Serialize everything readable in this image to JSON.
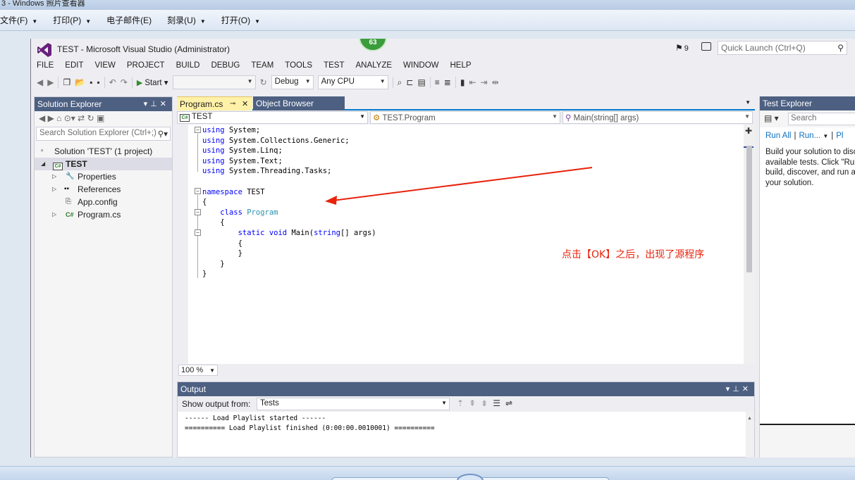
{
  "viewer": {
    "title": "3 - Windows 照片查看器",
    "menu": [
      "文件(F)",
      "打印(P)",
      "电子邮件(E)",
      "刻录(U)",
      "打开(O)"
    ]
  },
  "vs": {
    "title": "TEST - Microsoft Visual Studio (Administrator)",
    "badge": "63",
    "notifications": "9",
    "quick_launch_placeholder": "Quick Launch (Ctrl+Q)",
    "menu": [
      "FILE",
      "EDIT",
      "VIEW",
      "PROJECT",
      "BUILD",
      "DEBUG",
      "TEAM",
      "TOOLS",
      "TEST",
      "ANALYZE",
      "WINDOW",
      "HELP"
    ],
    "toolbar": {
      "start": "Start",
      "config": "Debug",
      "platform": "Any CPU"
    }
  },
  "solution_explorer": {
    "title": "Solution Explorer",
    "search_placeholder": "Search Solution Explorer (Ctrl+;)",
    "items": [
      {
        "label": "Solution 'TEST' (1 project)"
      },
      {
        "label": "TEST"
      },
      {
        "label": "Properties"
      },
      {
        "label": "References"
      },
      {
        "label": "App.config"
      },
      {
        "label": "Program.cs"
      }
    ]
  },
  "editor": {
    "tabs": [
      "Program.cs",
      "Object Browser"
    ],
    "nav": {
      "project": "TEST",
      "class": "TEST.Program",
      "member": "Main(string[] args)"
    },
    "code": {
      "using1": "System;",
      "using2": "System.Collections.Generic;",
      "using3": "System.Linq;",
      "using4": "System.Text;",
      "using5": "System.Threading.Tasks;",
      "using_kw": "using",
      "namespace_kw": "namespace",
      "namespace_name": " TEST",
      "brace_open": "{",
      "brace_close": "}",
      "class_kw": "class",
      "class_name": "Program",
      "static_kw": "static",
      "void_kw": "void",
      "main_name": " Main(",
      "string_kw": "string",
      "main_args": "[] args)"
    },
    "zoom": "100 %"
  },
  "annotation": "点击【OK】之后，出现了源程序",
  "output": {
    "title": "Output",
    "show_from_label": "Show output from:",
    "source": "Tests",
    "lines": [
      "------ Load Playlist started ------",
      "========== Load Playlist finished (0:00:00.0010001) =========="
    ]
  },
  "test_explorer": {
    "title": "Test Explorer",
    "search_placeholder": "Search",
    "run_all": "Run All",
    "run": "Run...",
    "playlist": "Pl",
    "description": "Build your solution to discover all available tests. Click \"Run All\" to build, discover, and run all tests in your solution."
  }
}
